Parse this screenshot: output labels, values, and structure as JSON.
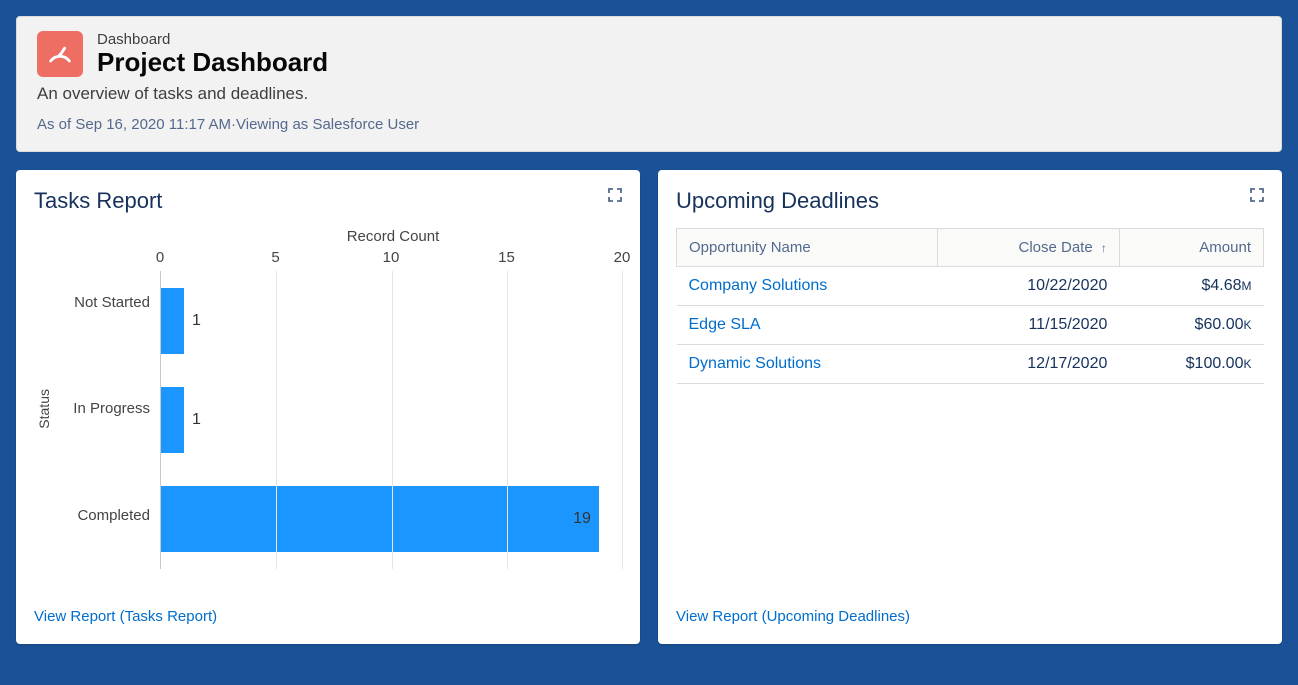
{
  "header": {
    "eyebrow": "Dashboard",
    "title": "Project Dashboard",
    "description": "An overview of tasks and deadlines.",
    "meta": "As of Sep 16, 2020 11:17 AM·Viewing as Salesforce User"
  },
  "tasks_panel": {
    "title": "Tasks Report",
    "view_link": "View Report (Tasks Report)"
  },
  "deadlines_panel": {
    "title": "Upcoming Deadlines",
    "view_link": "View Report (Upcoming Deadlines)",
    "columns": {
      "opportunity": "Opportunity Name",
      "close_date": "Close Date",
      "amount": "Amount"
    },
    "sort_indicator": "↑",
    "rows": [
      {
        "name": "Company Solutions",
        "close_date": "10/22/2020",
        "amount_display": "$4.68",
        "unit": "M"
      },
      {
        "name": "Edge SLA",
        "close_date": "11/15/2020",
        "amount_display": "$60.00",
        "unit": "K"
      },
      {
        "name": "Dynamic Solutions",
        "close_date": "12/17/2020",
        "amount_display": "$100.00",
        "unit": "K"
      }
    ]
  },
  "chart_data": {
    "type": "bar",
    "orientation": "horizontal",
    "title": "",
    "xlabel": "Record Count",
    "ylabel": "Status",
    "categories": [
      "Not Started",
      "In Progress",
      "Completed"
    ],
    "values": [
      1,
      1,
      19
    ],
    "ticks": [
      0,
      5,
      10,
      15,
      20
    ],
    "xlim": [
      0,
      20
    ]
  }
}
